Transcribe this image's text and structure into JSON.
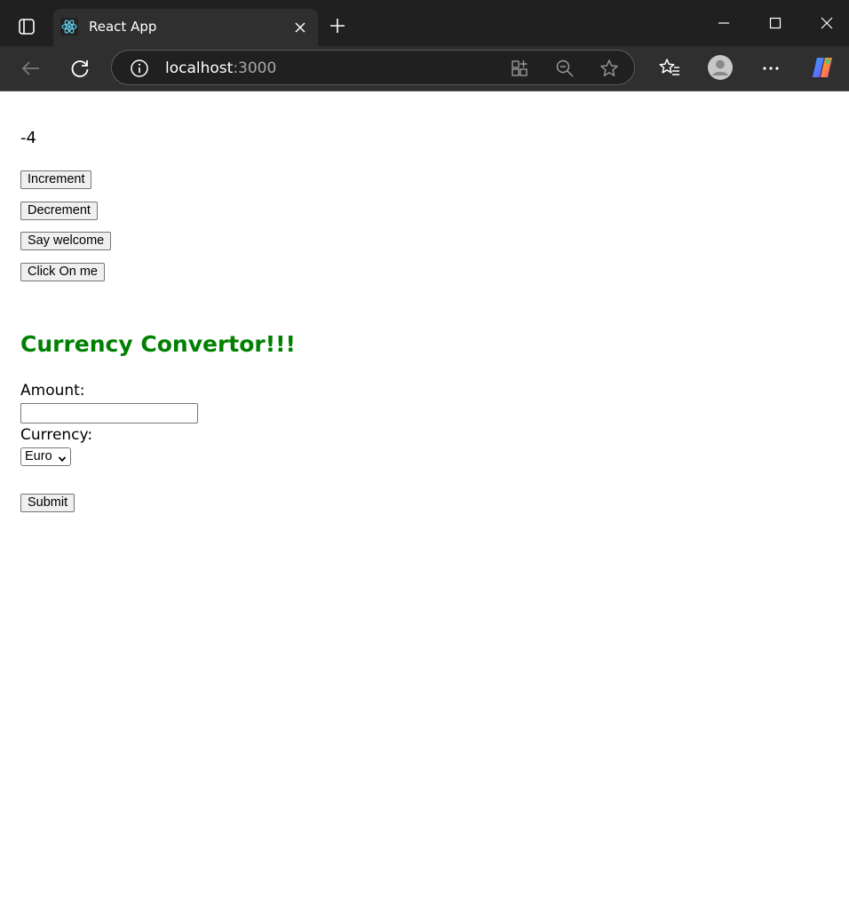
{
  "browser": {
    "tab_title": "React App",
    "url_host": "localhost",
    "url_port": ":3000"
  },
  "app": {
    "counter_value": "-4",
    "buttons": {
      "increment": "Increment",
      "decrement": "Decrement",
      "say_welcome": "Say welcome",
      "click_on_me": "Click On me"
    },
    "currency": {
      "heading": "Currency Convertor!!!",
      "heading_color": "#008000",
      "amount_label": "Amount:",
      "amount_value": "",
      "currency_label": "Currency:",
      "currency_selected": "Euro",
      "submit_label": "Submit"
    }
  }
}
